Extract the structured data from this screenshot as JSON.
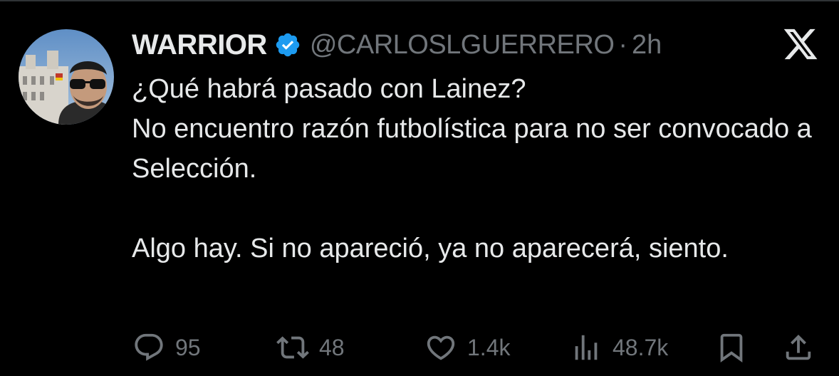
{
  "author": {
    "display_name": "WARRIOR",
    "handle": "@CARLOSLGUERRERO",
    "separator": "·",
    "time": "2h",
    "verified": true,
    "verified_color": "#1d9bf0"
  },
  "tweet": {
    "line1": "¿Qué habrá pasado con Lainez?",
    "line2": "No encuentro razón futbolística para no ser convocado a Selección.",
    "line3": "Algo hay. Si no apareció, ya no aparecerá, siento."
  },
  "actions": {
    "reply_icon": "reply-icon",
    "replies": "95",
    "retweet_icon": "retweet-icon",
    "retweets": "48",
    "like_icon": "heart-icon",
    "likes": "1.4k",
    "views_icon": "views-icon",
    "views": "48.7k",
    "bookmark_icon": "bookmark-icon",
    "share_icon": "share-icon"
  },
  "brand": {
    "logo": "x-logo-icon"
  },
  "colors": {
    "background": "#000000",
    "text": "#e7e9ea",
    "muted": "#71767b",
    "accent": "#1d9bf0"
  }
}
